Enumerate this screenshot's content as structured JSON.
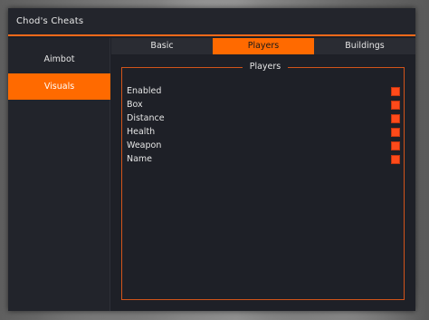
{
  "window": {
    "title": "Chod's Cheats"
  },
  "sidebar": {
    "items": [
      {
        "label": "Aimbot",
        "active": false
      },
      {
        "label": "Visuals",
        "active": true
      }
    ]
  },
  "tabs": [
    {
      "label": "Basic",
      "active": false
    },
    {
      "label": "Players",
      "active": true
    },
    {
      "label": "Buildings",
      "active": false
    }
  ],
  "players_group": {
    "title": "Players",
    "options": [
      {
        "label": "Enabled",
        "checked": true
      },
      {
        "label": "Box",
        "checked": true
      },
      {
        "label": "Distance",
        "checked": true
      },
      {
        "label": "Health",
        "checked": true
      },
      {
        "label": "Weapon",
        "checked": true
      },
      {
        "label": "Name",
        "checked": true
      }
    ]
  },
  "colors": {
    "accent": "#ff6a00",
    "checkbox": "#ff4a1a",
    "panel": "#1e2027",
    "text": "#e6e6e6"
  }
}
